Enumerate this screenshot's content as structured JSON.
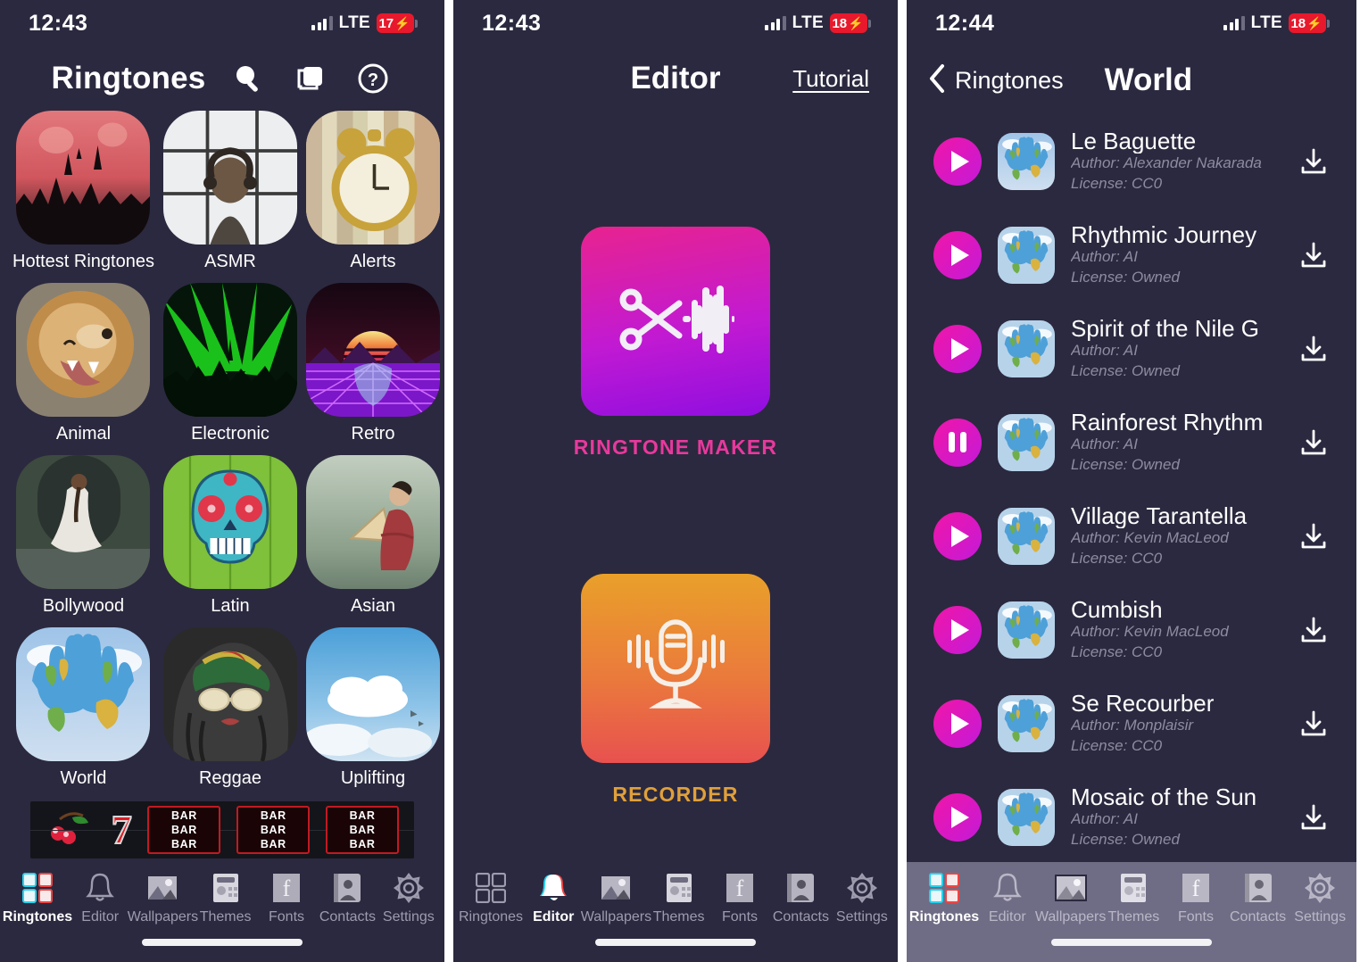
{
  "colors": {
    "background": "#2b293f",
    "accent_magenta": "#e8238f",
    "accent_purple": "#8f0ee0",
    "accent_orange": "#e9a02a",
    "tab_inactive": "#9d9bad",
    "battery_red": "#e8192c"
  },
  "panel1": {
    "status": {
      "time": "12:43",
      "network": "LTE",
      "battery": "17",
      "charging": "⚡"
    },
    "header": {
      "title": "Ringtones",
      "search_icon": "search-icon",
      "copy_icon": "copy-icon",
      "help_icon": "help-icon"
    },
    "categories": [
      {
        "label": "Hottest Ringtones",
        "art": "concert"
      },
      {
        "label": "ASMR",
        "art": "headphones"
      },
      {
        "label": "Alerts",
        "art": "clock"
      },
      {
        "label": "Animal",
        "art": "lion"
      },
      {
        "label": "Electronic",
        "art": "laser"
      },
      {
        "label": "Retro",
        "art": "synthwave"
      },
      {
        "label": "Bollywood",
        "art": "dancer"
      },
      {
        "label": "Latin",
        "art": "skull"
      },
      {
        "label": "Asian",
        "art": "asian"
      },
      {
        "label": "World",
        "art": "hands"
      },
      {
        "label": "Reggae",
        "art": "reggae"
      },
      {
        "label": "Uplifting",
        "art": "clouds"
      }
    ],
    "banner": {
      "cherries": "cherries-icon",
      "seven": "7",
      "bar_text": "BAR",
      "reels": 3
    },
    "tabs": [
      {
        "label": "Ringtones",
        "icon": "grid-icon",
        "active": true
      },
      {
        "label": "Editor",
        "icon": "bell-icon",
        "active": false
      },
      {
        "label": "Wallpapers",
        "icon": "image-icon",
        "active": false
      },
      {
        "label": "Themes",
        "icon": "keyboard-icon",
        "active": false
      },
      {
        "label": "Fonts",
        "icon": "font-icon",
        "active": false
      },
      {
        "label": "Contacts",
        "icon": "contact-icon",
        "active": false
      },
      {
        "label": "Settings",
        "icon": "gear-icon",
        "active": false
      }
    ]
  },
  "panel2": {
    "status": {
      "time": "12:43",
      "network": "LTE",
      "battery": "18",
      "charging": "⚡"
    },
    "header": {
      "title": "Editor",
      "tutorial_label": "Tutorial"
    },
    "tiles": [
      {
        "caption": "RINGTONE MAKER",
        "icon": "scissors-waveform-icon"
      },
      {
        "caption": "RECORDER",
        "icon": "microphone-icon"
      }
    ],
    "tabs": [
      {
        "label": "Ringtones",
        "icon": "grid-icon",
        "active": false
      },
      {
        "label": "Editor",
        "icon": "bell-icon",
        "active": true
      },
      {
        "label": "Wallpapers",
        "icon": "image-icon",
        "active": false
      },
      {
        "label": "Themes",
        "icon": "keyboard-icon",
        "active": false
      },
      {
        "label": "Fonts",
        "icon": "font-icon",
        "active": false
      },
      {
        "label": "Contacts",
        "icon": "contact-icon",
        "active": false
      },
      {
        "label": "Settings",
        "icon": "gear-icon",
        "active": false
      }
    ]
  },
  "panel3": {
    "status": {
      "time": "12:44",
      "network": "LTE",
      "battery": "18",
      "charging": "⚡"
    },
    "header": {
      "back_label": "Ringtones",
      "title": "World",
      "back_icon": "chevron-left-icon"
    },
    "ringtones": [
      {
        "title": "Le Baguette",
        "author": "Author: Alexander Nakarada",
        "license": "License: CC0",
        "state": "play"
      },
      {
        "title": "Rhythmic Journey",
        "author": "Author: AI",
        "license": "License: Owned",
        "state": "play"
      },
      {
        "title": "Spirit of the Nile G",
        "author": "Author: AI",
        "license": "License: Owned",
        "state": "play"
      },
      {
        "title": "Rainforest Rhythm",
        "author": "Author: AI",
        "license": "License: Owned",
        "state": "pause"
      },
      {
        "title": "Village Tarantella",
        "author": "Author: Kevin MacLeod",
        "license": "License: CC0",
        "state": "play"
      },
      {
        "title": "Cumbish",
        "author": "Author: Kevin MacLeod",
        "license": "License: CC0",
        "state": "play"
      },
      {
        "title": "Se Recourber",
        "author": "Author: Monplaisir",
        "license": "License: CC0",
        "state": "play"
      },
      {
        "title": "Mosaic of the Sun",
        "author": "Author: AI",
        "license": "License: Owned",
        "state": "play"
      }
    ],
    "tabs": [
      {
        "label": "Ringtones",
        "icon": "grid-icon",
        "active": true
      },
      {
        "label": "Editor",
        "icon": "bell-icon",
        "active": false
      },
      {
        "label": "Wallpapers",
        "icon": "image-icon",
        "active": false
      },
      {
        "label": "Themes",
        "icon": "keyboard-icon",
        "active": false
      },
      {
        "label": "Fonts",
        "icon": "font-icon",
        "active": false
      },
      {
        "label": "Contacts",
        "icon": "contact-icon",
        "active": false
      },
      {
        "label": "Settings",
        "icon": "gear-icon",
        "active": false
      }
    ]
  }
}
